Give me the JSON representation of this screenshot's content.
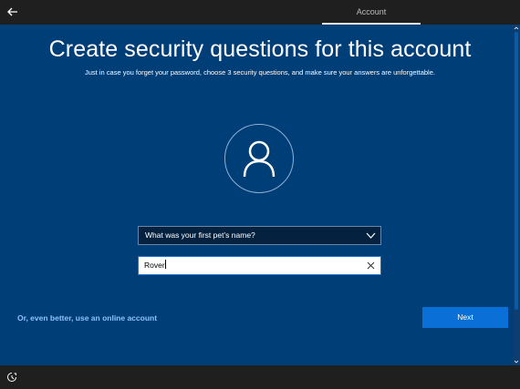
{
  "header": {
    "back_icon": "back-arrow-icon",
    "tab_label": "Account"
  },
  "main": {
    "title": "Create security questions for this account",
    "subtitle": "Just in case you forget your password, choose 3 security questions, and make sure your answers are unforgettable.",
    "avatar_icon": "user-icon",
    "question": {
      "selected": "What was your first pet’s name?",
      "icon": "chevron-down-icon"
    },
    "answer": {
      "value": "Rover",
      "clear_icon": "clear-icon"
    },
    "online_account_link": "Or, even better, use an online account",
    "next_label": "Next"
  },
  "footer": {
    "ease_of_access_icon": "ease-of-access-icon"
  },
  "colors": {
    "background": "#003e78",
    "accent": "#0a6fd6",
    "link": "#8ec2ff",
    "bar": "#1f1f1f"
  }
}
